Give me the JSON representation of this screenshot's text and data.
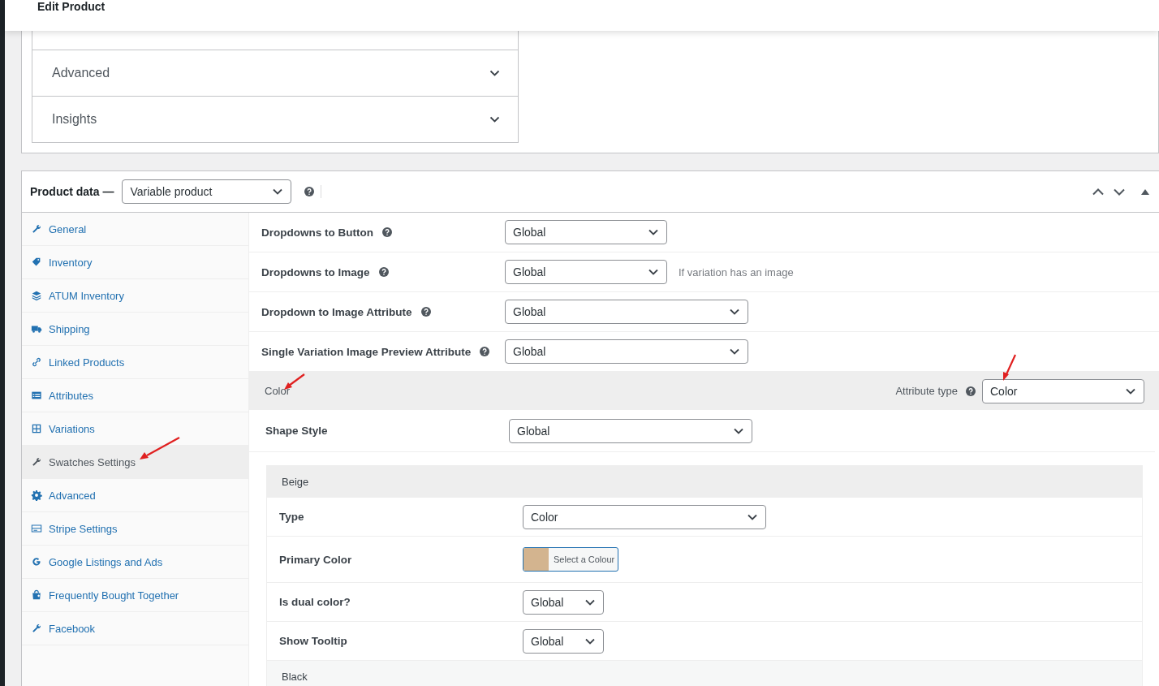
{
  "header": {
    "title": "Edit Product"
  },
  "accordion": [
    {
      "label": "Advanced",
      "expanded": false
    },
    {
      "label": "Insights",
      "expanded": false
    }
  ],
  "product_data": {
    "label": "Product data —",
    "product_type": "Variable product"
  },
  "tabs": [
    {
      "label": "General",
      "selected": false
    },
    {
      "label": "Inventory",
      "selected": false
    },
    {
      "label": "ATUM Inventory",
      "selected": false
    },
    {
      "label": "Shipping",
      "selected": false
    },
    {
      "label": "Linked Products",
      "selected": false
    },
    {
      "label": "Attributes",
      "selected": false
    },
    {
      "label": "Variations",
      "selected": false
    },
    {
      "label": "Swatches Settings",
      "selected": true
    },
    {
      "label": "Advanced",
      "selected": false
    },
    {
      "label": "Stripe Settings",
      "selected": false
    },
    {
      "label": "Google Listings and Ads",
      "selected": false
    },
    {
      "label": "Frequently Bought Together",
      "selected": false
    },
    {
      "label": "Facebook",
      "selected": false
    }
  ],
  "settings": [
    {
      "label": "Dropdowns to Button",
      "value": "Global"
    },
    {
      "label": "Dropdowns to Image",
      "value": "Global",
      "hint": "If variation has an image"
    },
    {
      "label": "Dropdown to Image Attribute",
      "value": "Global"
    },
    {
      "label": "Single Variation Image Preview Attribute",
      "value": "Global"
    }
  ],
  "attribute": {
    "name": "Color",
    "type_label": "Attribute type",
    "type_value": "Color",
    "shape_style": {
      "label": "Shape Style",
      "value": "Global"
    },
    "terms": [
      {
        "name": "Beige",
        "fields": [
          {
            "kind": "select",
            "label": "Type",
            "value": "Color"
          },
          {
            "kind": "color",
            "label": "Primary Color",
            "color": "#d3b48f",
            "button": "Select a Colour"
          },
          {
            "kind": "short-select",
            "label": "Is dual color?",
            "value": "Global"
          },
          {
            "kind": "short-select",
            "label": "Show Tooltip",
            "value": "Global"
          }
        ]
      },
      {
        "name": "Black"
      }
    ]
  }
}
